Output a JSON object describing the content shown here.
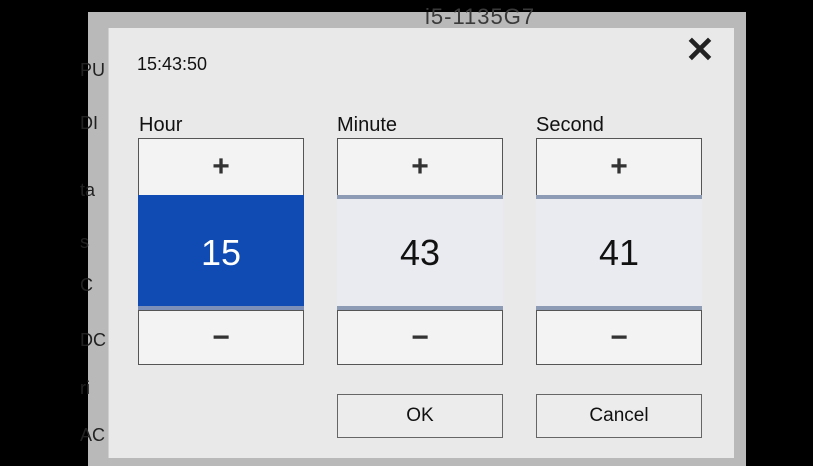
{
  "background": {
    "top_text": "i5-1135G7",
    "left_labels": [
      "PU",
      "DI",
      "ta",
      "s",
      "C",
      "DC",
      "ri",
      "AC"
    ]
  },
  "dialog": {
    "time": "15:43:50",
    "close_icon": "close-icon",
    "columns": [
      {
        "label": "Hour",
        "value": "15",
        "plus": "+",
        "minus": "−",
        "active": true
      },
      {
        "label": "Minute",
        "value": "43",
        "plus": "+",
        "minus": "−",
        "active": false
      },
      {
        "label": "Second",
        "value": "41",
        "plus": "+",
        "minus": "−",
        "active": false
      }
    ],
    "ok_label": "OK",
    "cancel_label": "Cancel",
    "close_glyph": "✕"
  },
  "colors": {
    "active_value_bg": "#0f4bb3",
    "separator": "#8e9bb5"
  }
}
